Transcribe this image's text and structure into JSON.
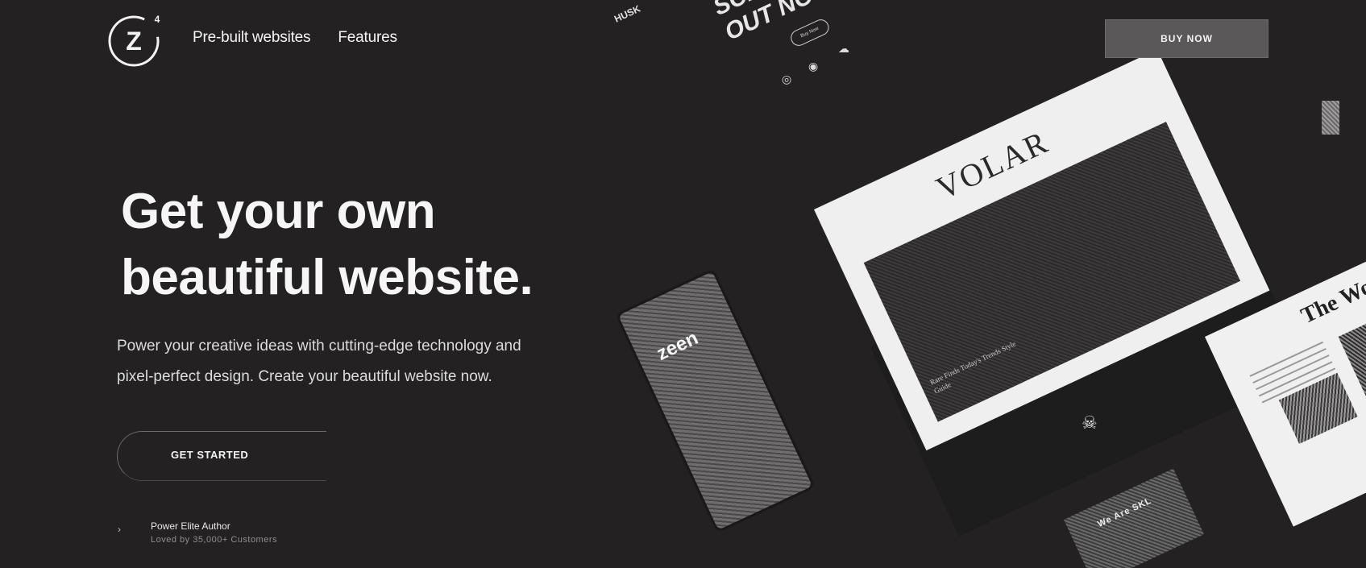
{
  "header": {
    "logo_letter": "Z",
    "logo_superscript": "4",
    "nav": [
      {
        "label": "Pre-built websites"
      },
      {
        "label": "Features"
      }
    ],
    "buy_label": "BUY NOW"
  },
  "hero": {
    "title_line1": "Get your own",
    "title_line2": "beautiful website.",
    "subtitle_line1": "Power your creative ideas with cutting-edge technology and",
    "subtitle_line2": "pixel-perfect design. Create your beautiful website now.",
    "cta_label": "GET STARTED",
    "author_title": "Power Elite Author",
    "author_sub": "Loved by 35,000+ Customers"
  },
  "showcase": {
    "volar_title": "VOLAR",
    "volar_caption": "Rare Finds Today's Trends Style Guide",
    "phone_logo": "zeen",
    "newspaper_title": "The World",
    "skl_title": "We Are SKL",
    "screen_line1": "SCREAM",
    "screen_line2": "OUT NOW",
    "husk": "HUSK",
    "mini_button": "Buy Now"
  },
  "colors": {
    "background": "#232122",
    "text": "#f2f2f2",
    "button_bg": "#5a5859"
  }
}
